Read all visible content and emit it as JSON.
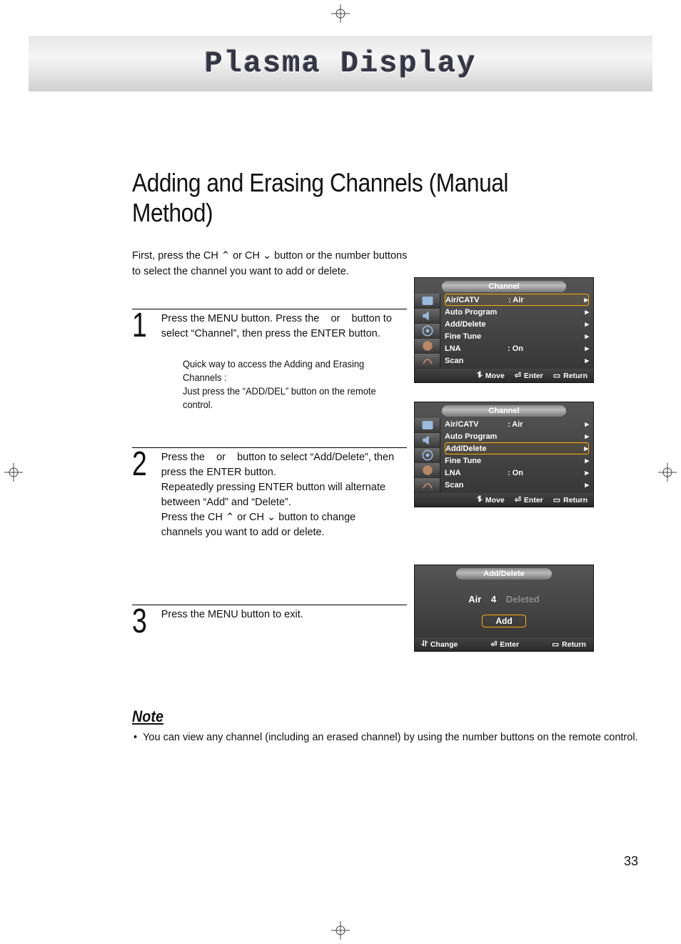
{
  "banner": {
    "title": "Plasma Display"
  },
  "page": {
    "title": "Adding and Erasing Channels (Manual Method)",
    "intro_line1": "First, press the CH ⌃ or CH ⌄ button or the number buttons",
    "intro_line2": "to select the channel you want to add or delete.",
    "pagenum": "33"
  },
  "steps": [
    {
      "num": "1",
      "text": "Press the MENU button. Press the    or    button to select “Channel”, then press the ENTER button.",
      "hint_line1": "Quick way to access the Adding and Erasing Channels :",
      "hint_line2": "Just press the “ADD/DEL” button on the remote control."
    },
    {
      "num": "2",
      "text_a": "Press the    or    button to select “Add/Delete”, then press the ENTER button.",
      "text_b": "Repeatedly pressing ENTER button will alternate between “Add” and “Delete”.",
      "text_c": "Press the CH ⌃ or CH ⌄ button to change channels you want to add or delete."
    },
    {
      "num": "3",
      "text": "Press the MENU button to exit."
    }
  ],
  "osd": {
    "title": "Channel",
    "rows": [
      {
        "label": "Air/CATV",
        "value": ":  Air"
      },
      {
        "label": "Auto Program",
        "value": ""
      },
      {
        "label": "Add/Delete",
        "value": ""
      },
      {
        "label": "Fine Tune",
        "value": ""
      },
      {
        "label": "LNA",
        "value": ":  On"
      },
      {
        "label": "Scan",
        "value": ""
      }
    ],
    "footer": {
      "move": "Move",
      "enter": "Enter",
      "ret": "Return"
    }
  },
  "osd_ad": {
    "title": "Add/Delete",
    "source": "Air",
    "channel": "4",
    "status": "Deleted",
    "button": "Add",
    "footer": {
      "change": "Change",
      "enter": "Enter",
      "ret": "Return"
    }
  },
  "note": {
    "heading": "Note",
    "text": "You can view any channel (including an erased channel) by using the number buttons on the remote control."
  }
}
